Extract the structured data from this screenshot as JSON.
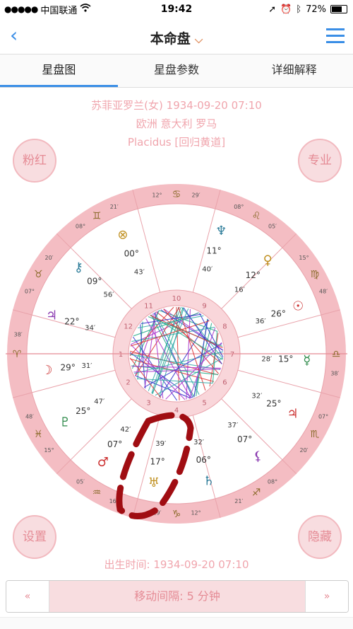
{
  "status": {
    "signal": "●●●●●",
    "carrier": "中国联通",
    "wifi": "wifi-icon",
    "time": "19:42",
    "battery_percent": "72%",
    "battery_level": 0.72
  },
  "nav": {
    "back": "‹",
    "title": "本命盘",
    "caret": "⌵",
    "menu_icon": "menu-icon"
  },
  "tabs": [
    {
      "label": "星盘图",
      "active": true
    },
    {
      "label": "星盘参数",
      "active": false
    },
    {
      "label": "详细解释",
      "active": false
    }
  ],
  "person": {
    "line1": "苏菲亚罗兰(女) 1934-09-20 07:10",
    "line2": "欧洲 意大利 罗马",
    "line3": "Placidus [回归黄道]"
  },
  "buttons": {
    "pink": "粉红",
    "pro": "专业",
    "settings": "设置",
    "hide": "隐藏"
  },
  "birth_time": "出生时间: 1934-09-20 07:10",
  "stepper": {
    "prev": "«",
    "label": "移动间隔: 5 分钟",
    "next": "»"
  },
  "chart_data": {
    "type": "astrology-wheel",
    "houses": [
      "1",
      "2",
      "3",
      "4",
      "5",
      "6",
      "7",
      "8",
      "9",
      "10",
      "11",
      "12"
    ],
    "cusps": [
      {
        "sign": "♋",
        "deg": "12°",
        "min": "29′"
      },
      {
        "sign": "♌",
        "deg": "08°",
        "min": "05′"
      },
      {
        "sign": "♍",
        "deg": "15°",
        "min": "48′"
      },
      {
        "sign": "♎",
        "deg": "",
        "min": "38′"
      },
      {
        "sign": "♏",
        "deg": "07°",
        "min": "20′"
      },
      {
        "sign": "♐",
        "deg": "08°",
        "min": "21′"
      },
      {
        "sign": "♑",
        "deg": "12°",
        "min": "29′"
      },
      {
        "sign": "♒",
        "deg": "16°",
        "min": "05′"
      },
      {
        "sign": "♓",
        "deg": "15°",
        "min": "48′"
      },
      {
        "sign": "♈",
        "deg": "",
        "min": "38′"
      },
      {
        "sign": "♉",
        "deg": "07°",
        "min": "20′"
      },
      {
        "sign": "♊",
        "deg": "08°",
        "min": "21′"
      }
    ],
    "planets": [
      {
        "glyph": "♆",
        "deg": "11°",
        "min": "40′"
      },
      {
        "glyph": "♀",
        "deg": "12°",
        "min": "16′"
      },
      {
        "glyph": "☉",
        "deg": "26°",
        "min": "36′"
      },
      {
        "glyph": "☿",
        "deg": "15°",
        "min": "28′"
      },
      {
        "glyph": "♃",
        "deg": "25°",
        "min": "32′"
      },
      {
        "glyph": "⚸",
        "deg": "07°",
        "min": "37′"
      },
      {
        "glyph": "♄",
        "deg": "06°",
        "min": "32′"
      },
      {
        "glyph": "♅",
        "deg": "17°",
        "min": "39′"
      },
      {
        "glyph": "♂",
        "deg": "07°",
        "min": "42′"
      },
      {
        "glyph": "♇",
        "deg": "25°",
        "min": "47′"
      },
      {
        "glyph": "☽",
        "deg": "29°",
        "min": "31′"
      },
      {
        "glyph": "♃",
        "deg": "22°",
        "min": "34′"
      },
      {
        "glyph": "⚷",
        "deg": "09°",
        "min": "56′"
      },
      {
        "glyph": "⊗",
        "deg": "00°",
        "min": "43′"
      }
    ],
    "aspect_line_count": 60,
    "aspect_colors": [
      "#d33",
      "#2a8",
      "#33c",
      "#a3c",
      "#3aa"
    ]
  }
}
